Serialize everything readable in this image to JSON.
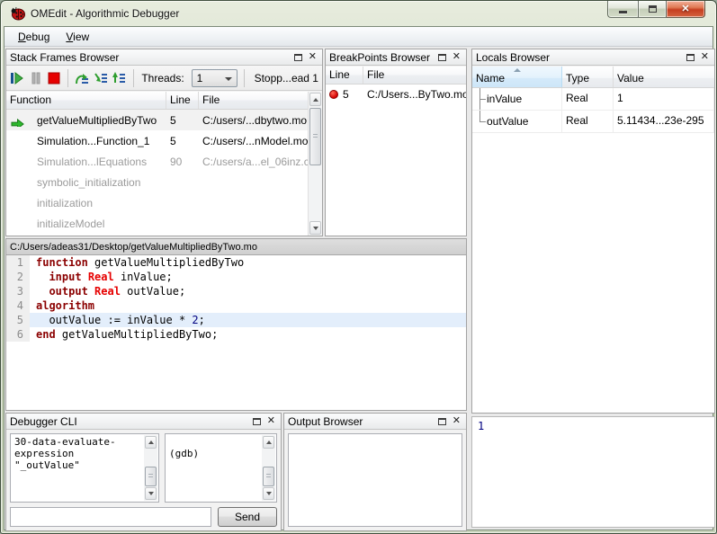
{
  "window": {
    "title": "OMEdit - Algorithmic Debugger"
  },
  "menu": {
    "items": [
      "Debug",
      "View"
    ]
  },
  "stack_frames": {
    "title": "Stack Frames Browser",
    "toolbar": {
      "icons": [
        "resume-icon",
        "interrupt-icon",
        "stop-icon",
        "step-over-icon",
        "step-into-icon",
        "step-return-icon"
      ],
      "threads_label": "Threads:",
      "threads_value": "1",
      "status": "Stopp...ead 1"
    },
    "columns": [
      "Function",
      "Line",
      "File"
    ],
    "rows": [
      {
        "function": "getValueMultipliedByTwo",
        "line": "5",
        "file": "C:/users/...dbytwo.mo",
        "current": true,
        "dim": false
      },
      {
        "function": "Simulation...Function_1",
        "line": "5",
        "file": "C:/users/...nModel.mo",
        "current": false,
        "dim": false
      },
      {
        "function": "Simulation...lEquations",
        "line": "90",
        "file": "C:/users/a...el_06inz.c",
        "current": false,
        "dim": true
      },
      {
        "function": "symbolic_initialization",
        "line": "",
        "file": "",
        "current": false,
        "dim": true
      },
      {
        "function": "initialization",
        "line": "",
        "file": "",
        "current": false,
        "dim": true
      },
      {
        "function": "initializeModel",
        "line": "",
        "file": "",
        "current": false,
        "dim": true
      }
    ]
  },
  "breakpoints": {
    "title": "BreakPoints Browser",
    "columns": [
      "Line",
      "File"
    ],
    "rows": [
      {
        "line": "5",
        "file": "C:/Users...ByTwo.mo"
      }
    ]
  },
  "locals": {
    "title": "Locals Browser",
    "columns": [
      "Name",
      "Type",
      "Value"
    ],
    "rows": [
      {
        "name": "inValue",
        "type": "Real",
        "value": "1"
      },
      {
        "name": "outValue",
        "type": "Real",
        "value": "5.11434...23e-295"
      }
    ]
  },
  "editor": {
    "path": "C:/Users/adeas31/Desktop/getValueMultipliedByTwo.mo",
    "highlight_line": 5,
    "lines": [
      {
        "num": "1",
        "hl": false,
        "segs": [
          {
            "c": "kw",
            "t": "function"
          },
          {
            "c": "pl",
            "t": " getValueMultipliedByTwo"
          }
        ]
      },
      {
        "num": "2",
        "hl": false,
        "segs": [
          {
            "c": "pl",
            "t": "  "
          },
          {
            "c": "kw",
            "t": "input"
          },
          {
            "c": "pl",
            "t": " "
          },
          {
            "c": "type",
            "t": "Real"
          },
          {
            "c": "pl",
            "t": " inValue;"
          }
        ]
      },
      {
        "num": "3",
        "hl": false,
        "segs": [
          {
            "c": "pl",
            "t": "  "
          },
          {
            "c": "kw",
            "t": "output"
          },
          {
            "c": "pl",
            "t": " "
          },
          {
            "c": "type",
            "t": "Real"
          },
          {
            "c": "pl",
            "t": " outValue;"
          }
        ]
      },
      {
        "num": "4",
        "hl": false,
        "segs": [
          {
            "c": "kw",
            "t": "algorithm"
          }
        ]
      },
      {
        "num": "5",
        "hl": true,
        "segs": [
          {
            "c": "pl",
            "t": "  outValue := inValue * "
          },
          {
            "c": "num",
            "t": "2"
          },
          {
            "c": "pl",
            "t": ";"
          }
        ]
      },
      {
        "num": "6",
        "hl": false,
        "segs": [
          {
            "c": "kw",
            "t": "end"
          },
          {
            "c": "pl",
            "t": " getValueMultipliedByTwo;"
          }
        ]
      }
    ]
  },
  "debugger_cli": {
    "title": "Debugger CLI",
    "command_text": "30-data-evaluate-\nexpression\n\"_outValue\"",
    "response_text": "\n(gdb)",
    "input_value": "",
    "send_label": "Send"
  },
  "output_browser": {
    "title": "Output Browser"
  },
  "value_view": {
    "text": "1"
  },
  "colors": {
    "keyword": "#8b0000",
    "type": "#e60000",
    "number": "#000080",
    "highlight_line": "#e3eefb",
    "breakpoint": "#d40000",
    "current_arrow": "#2db82d",
    "close_button": "#c63e20"
  }
}
